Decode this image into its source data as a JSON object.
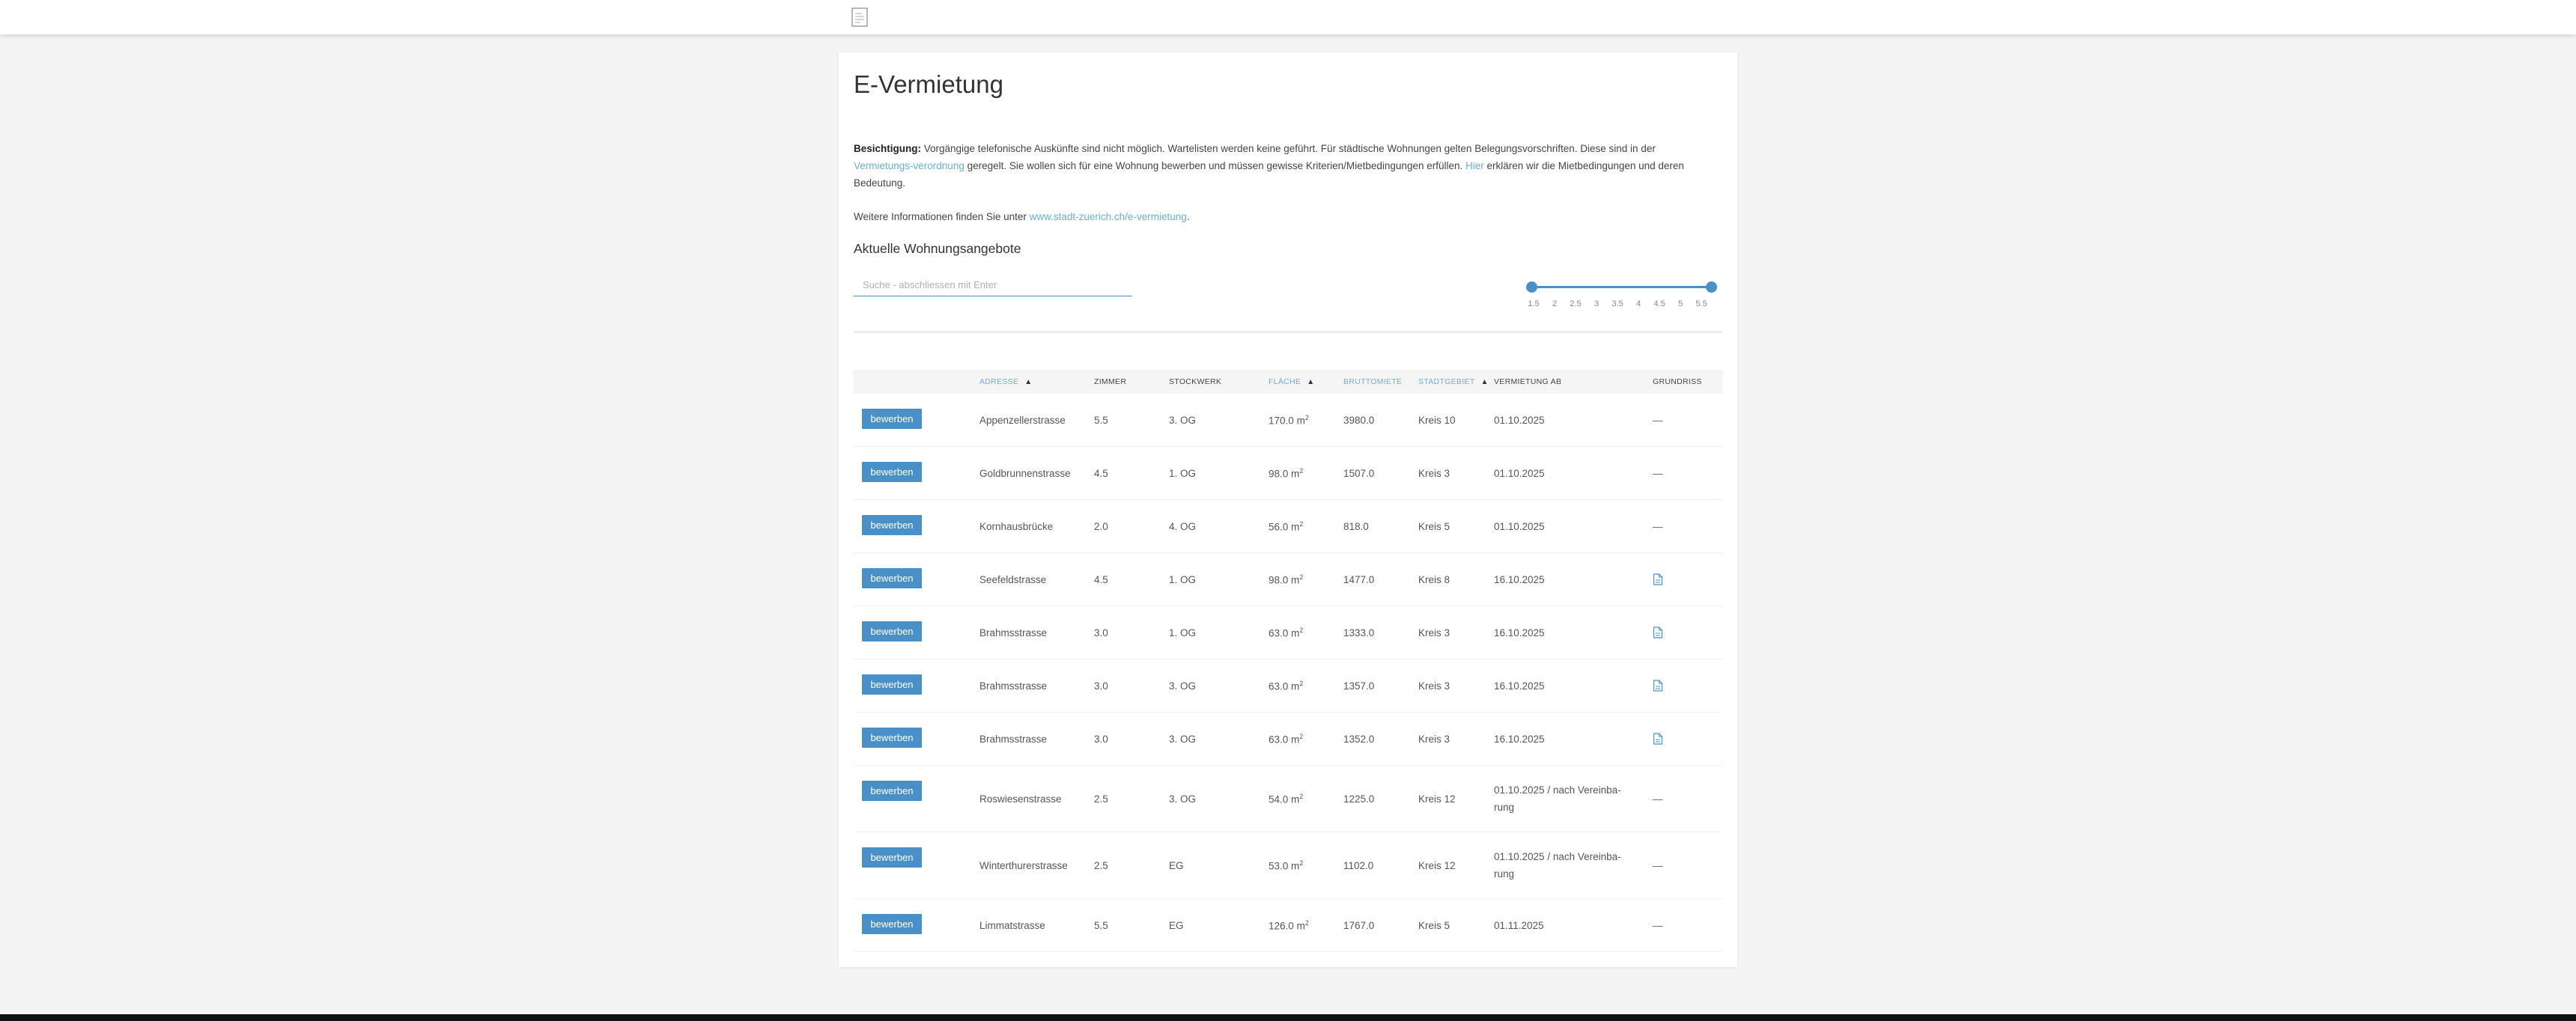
{
  "header": {
    "logo_icon": "document-icon"
  },
  "page": {
    "title": "E-Vermietung",
    "info_label": "Besichtigung:",
    "info_text_1": " Vorgängige telefonische Auskünfte sind nicht möglich. Wartelisten werden keine geführt. Für städtische Wohnungen gelten Belegungsvorschriften. Diese sind in der ",
    "info_link_1": "Vermietungs-verordnung",
    "info_text_2": " geregelt. Sie wollen sich für eine Wohnung bewerben und müssen gewisse Kriterien/Mietbedingungen erfüllen. ",
    "info_link_2": "Hier",
    "info_text_3": " erklären wir die Mietbedingungen und deren Bedeutung.",
    "more_text": "Weitere Informationen finden Sie unter ",
    "more_link": "www.stadt-zuerich.ch/e-vermietung",
    "more_end": ".",
    "listings_title": "Aktuelle Wohnungsangebote"
  },
  "search": {
    "placeholder": "Suche - abschliessen mit Enter"
  },
  "slider": {
    "ticks": [
      "1.5",
      "2",
      "2.5",
      "3",
      "3.5",
      "4",
      "4.5",
      "5",
      "5.5"
    ],
    "min_value": 1.5,
    "max_value": 5.5
  },
  "table": {
    "headers": [
      "",
      "ADRESSE",
      "ZIMMER",
      "STOCKWERK",
      "FLÄCHE",
      "BRUTTOMIETE",
      "STADTGEBIET",
      "VERMIETUNG AB",
      "GRUNDRISS"
    ],
    "apply_label": "bewerben",
    "area_unit": "m",
    "rows": [
      {
        "adresse": "Appenzellerstrasse",
        "zimmer": "5.5",
        "stockwerk": "3. OG",
        "flaeche": "170.0",
        "miete": "3980.0",
        "gebiet": "Kreis 10",
        "ab": "01.10.2025",
        "grundriss": "—"
      },
      {
        "adresse": "Goldbrunnenstrasse",
        "zimmer": "4.5",
        "stockwerk": "1. OG",
        "flaeche": "98.0",
        "miete": "1507.0",
        "gebiet": "Kreis 3",
        "ab": "01.10.2025",
        "grundriss": "—"
      },
      {
        "adresse": "Kornhausbrücke",
        "zimmer": "2.0",
        "stockwerk": "4. OG",
        "flaeche": "56.0",
        "miete": "818.0",
        "gebiet": "Kreis 5",
        "ab": "01.10.2025",
        "grundriss": "—"
      },
      {
        "adresse": "Seefeldstrasse",
        "zimmer": "4.5",
        "stockwerk": "1. OG",
        "flaeche": "98.0",
        "miete": "1477.0",
        "gebiet": "Kreis 8",
        "ab": "16.10.2025",
        "grundriss": "document-icon"
      },
      {
        "adresse": "Brahmsstrasse",
        "zimmer": "3.0",
        "stockwerk": "1. OG",
        "flaeche": "63.0",
        "miete": "1333.0",
        "gebiet": "Kreis 3",
        "ab": "16.10.2025",
        "grundriss": "document-icon"
      },
      {
        "adresse": "Brahmsstrasse",
        "zimmer": "3.0",
        "stockwerk": "3. OG",
        "flaeche": "63.0",
        "miete": "1357.0",
        "gebiet": "Kreis 3",
        "ab": "16.10.2025",
        "grundriss": "document-icon"
      },
      {
        "adresse": "Brahmsstrasse",
        "zimmer": "3.0",
        "stockwerk": "3. OG",
        "flaeche": "63.0",
        "miete": "1352.0",
        "gebiet": "Kreis 3",
        "ab": "16.10.2025",
        "grundriss": "document-icon"
      },
      {
        "adresse": "Roswiesenstrasse",
        "zimmer": "2.5",
        "stockwerk": "3. OG",
        "flaeche": "54.0",
        "miete": "1225.0",
        "gebiet": "Kreis 12",
        "ab": "01.10.2025 / nach Vereinba-rung",
        "grundriss": "—"
      },
      {
        "adresse": "Winterthurerstrasse",
        "zimmer": "2.5",
        "stockwerk": "EG",
        "flaeche": "53.0",
        "miete": "1102.0",
        "gebiet": "Kreis 12",
        "ab": "01.10.2025 / nach Vereinba-rung",
        "grundriss": "—"
      },
      {
        "adresse": "Limmatstrasse",
        "zimmer": "5.5",
        "stockwerk": "EG",
        "flaeche": "126.0",
        "miete": "1767.0",
        "gebiet": "Kreis 5",
        "ab": "01.11.2025",
        "grundriss": "—"
      }
    ]
  },
  "colors": {
    "accent": "#4a90c8",
    "link": "#6aaed6",
    "background": "#f4f4f4"
  }
}
